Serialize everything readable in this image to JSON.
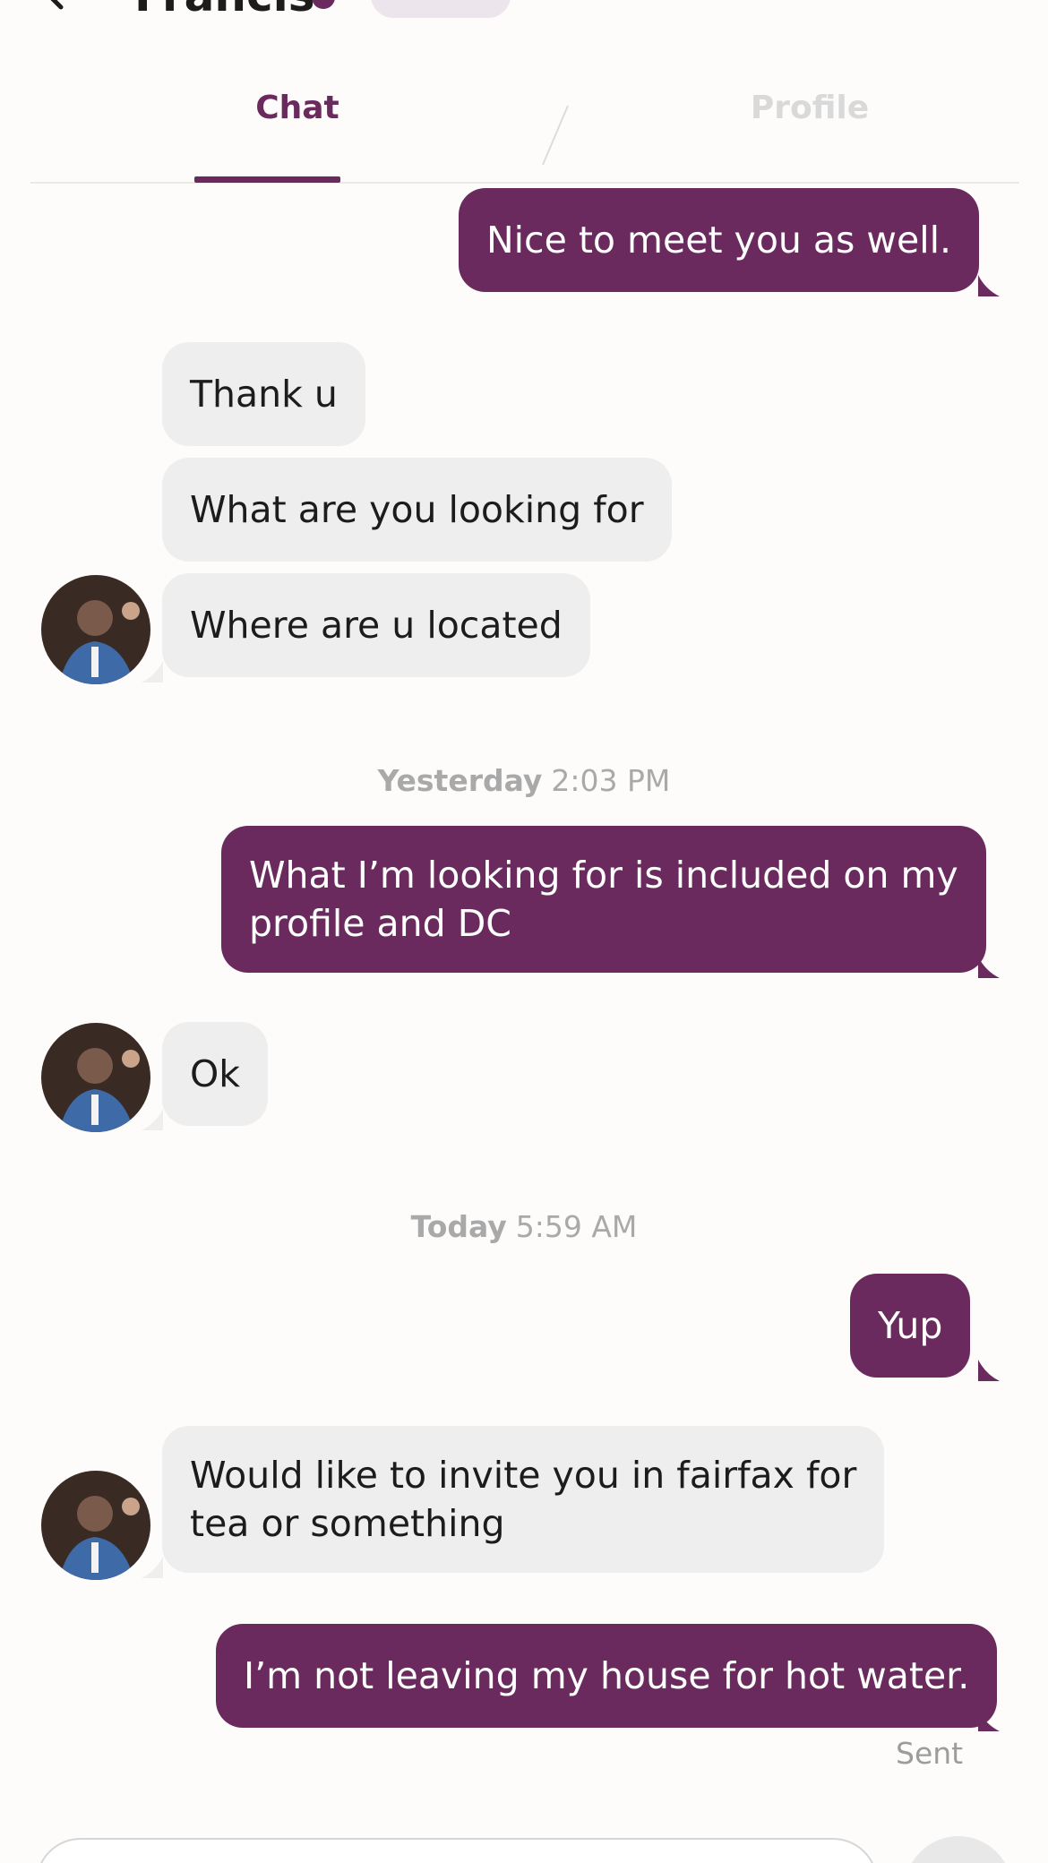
{
  "header": {
    "contact_name": "Francis",
    "back_icon": "chevron-left-icon",
    "verified_icon": "verified-badge-icon"
  },
  "tabs": [
    {
      "label": "Chat",
      "active": true
    },
    {
      "label": "Profile",
      "active": false
    }
  ],
  "messages": [
    {
      "from": "me",
      "text": "Nice to meet you as well."
    },
    {
      "from": "them",
      "text": "Thank u"
    },
    {
      "from": "them",
      "text": "What are you looking for"
    },
    {
      "from": "them",
      "text": "Where are u located"
    },
    {
      "type": "timestamp",
      "day": "Yesterday",
      "time": "2:03 PM"
    },
    {
      "from": "me",
      "text": "What I’m looking for is included on my\nprofile and DC"
    },
    {
      "from": "them",
      "text": "Ok"
    },
    {
      "type": "timestamp",
      "day": "Today",
      "time": "5:59 AM"
    },
    {
      "from": "me",
      "text": "Yup"
    },
    {
      "from": "them",
      "text": "Would like to invite you in fairfax for\ntea or something"
    },
    {
      "from": "me",
      "text": "I’m not leaving my house for hot water."
    }
  ],
  "status": {
    "last_message": "Sent"
  },
  "colors": {
    "accent": "#6a2a5d",
    "incoming_bubble": "#eeeeee",
    "background": "#fdfcfb",
    "timestamp": "#a9a9a9"
  }
}
